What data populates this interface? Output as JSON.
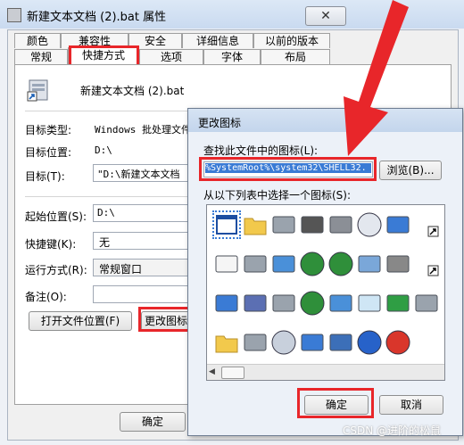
{
  "window": {
    "title": "新建文本文档 (2).bat 属性",
    "close": "✕"
  },
  "tabs_row1": [
    "颜色",
    "兼容性",
    "安全",
    "详细信息",
    "以前的版本"
  ],
  "tabs_row2": [
    "常规",
    "快捷方式",
    "选项",
    "字体",
    "布局"
  ],
  "shortcut": {
    "filename": "新建文本文档 (2).bat",
    "target_type_label": "目标类型:",
    "target_type_value": "Windows 批处理文件",
    "target_location_label": "目标位置:",
    "target_location_value": "D:\\",
    "target_label": "目标(T):",
    "target_value": "\"D:\\新建文本文档",
    "start_in_label": "起始位置(S):",
    "start_in_value": "D:\\",
    "shortcut_key_label": "快捷键(K):",
    "shortcut_key_value": "无",
    "run_label": "运行方式(R):",
    "run_value": "常规窗口",
    "comment_label": "备注(O):",
    "open_location_button": "打开文件位置(F)",
    "change_icon_button": "更改图标"
  },
  "footer": {
    "ok_button": "确定"
  },
  "dialog": {
    "title": "更改图标",
    "search_label": "查找此文件中的图标(L):",
    "path_value": "%SystemRoot%\\system32\\SHELL32.",
    "browse_button": "浏览(B)...",
    "choose_label": "从以下列表中选择一个图标(S):",
    "ok_button": "确定",
    "cancel_button": "取消"
  },
  "icons": [
    "application-window-icon",
    "folder-icon",
    "drive-icon",
    "chip-icon",
    "printer-icon",
    "clock-icon",
    "window-tile-icon",
    "small-arrow-icon",
    "document-icon",
    "network-drive-icon",
    "network-icon",
    "globe-icon",
    "network-globe-icon",
    "control-panel-icon",
    "floppy-icon",
    "shortcut-arrow-icon",
    "blank-window-icon",
    "save-disk-icon",
    "delete-drive-icon",
    "globe-link-icon",
    "network-computers-icon",
    "search-icon",
    "green-arrow-icon",
    "drive-small-icon",
    "open-folder-icon",
    "drive-flat-icon",
    "cd-icon",
    "run-window-icon",
    "desktop-icon",
    "help-icon",
    "power-icon"
  ],
  "watermark": "CSDN @进阶的松鼠",
  "colors": {
    "highlight": "#e8262a",
    "selection": "#3a7bd5"
  }
}
